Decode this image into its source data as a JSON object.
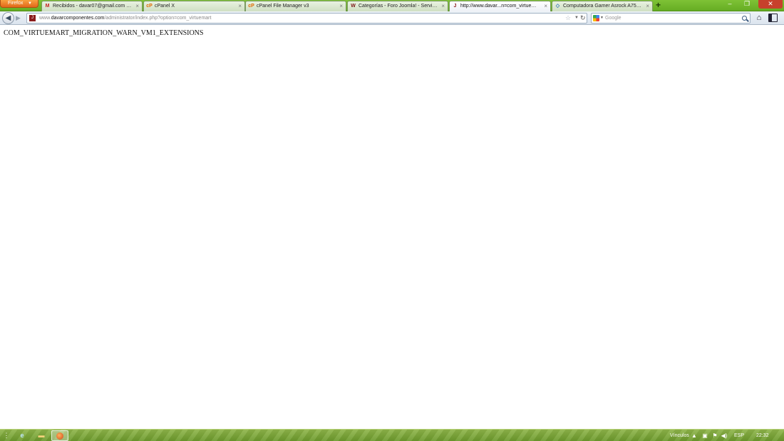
{
  "browser": {
    "menu_button": "Firefox",
    "tabs": [
      {
        "label": "Recibidos - davar07@gmail.com - G...",
        "icon": "M",
        "active": false
      },
      {
        "label": "cPanel X",
        "icon": "cP",
        "active": false
      },
      {
        "label": "cPanel File Manager v3",
        "icon": "cP",
        "active": false
      },
      {
        "label": "Categorías - Foro Joomla! - Servicios ...",
        "icon": "W",
        "active": false
      },
      {
        "label": "http://www.davar...n=com_virtuemart",
        "icon": "J",
        "active": true
      },
      {
        "label": "Computadora Gamer Asrock A75 Extr...",
        "icon": "◇",
        "active": false
      }
    ],
    "new_tab": "+",
    "window_controls": {
      "minimize": "–",
      "maximize": "❐",
      "close": "✕"
    }
  },
  "navbar": {
    "url_prefix": "www.",
    "url_host": "davarcomponentes.com",
    "url_path": "/administrator/index.php?option=com_virtuemart",
    "search_placeholder": "Google"
  },
  "page": {
    "message": "COM_VIRTUEMART_MIGRATION_WARN_VM1_EXTENSIONS"
  },
  "taskbar": {
    "links_label": "Vínculos",
    "language": "ESP",
    "clock": "22:32"
  }
}
